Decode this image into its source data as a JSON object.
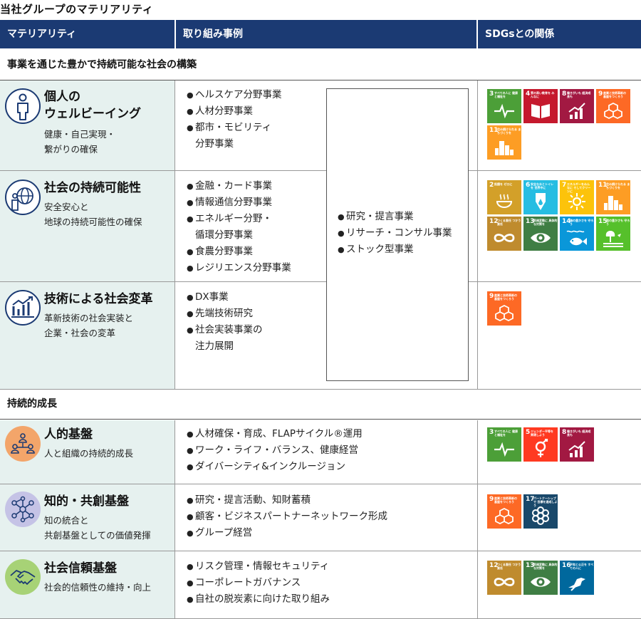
{
  "page_title": "当社グループのマテリアリティ",
  "header": {
    "col1": "マテリアリティ",
    "col2": "取り組み事例",
    "col3": "SDGsとの関係"
  },
  "sections": {
    "s1": "事業を通じた豊かで持続可能な社会の構築",
    "s2": "持続的成長"
  },
  "colors": {
    "header": "#1b3a73",
    "mat_bg": "#e6f1ef",
    "icon_blue": "#1b3a73",
    "icon_orange": "#f3a56a",
    "icon_lavender": "#c5c3e6",
    "icon_green": "#a7d276"
  },
  "rows": [
    {
      "title": "個人の\nウェルビーイング",
      "desc": "健康・自己実現・\n繋がりの確保",
      "icon": "person-icon",
      "items": [
        "ヘルスケア分野事業",
        "人材分野事業",
        "都市・モビリティ\n分野事業"
      ],
      "sdgs": [
        3,
        4,
        8,
        9,
        11
      ]
    },
    {
      "title": "社会の持続可能性",
      "desc": "安全安心と\n地球の持続可能性の確保",
      "icon": "globe-person-icon",
      "items": [
        "金融・カード事業",
        "情報通信分野事業",
        "エネルギー分野・\n循環分野事業",
        "食農分野事業",
        "レジリエンス分野事業"
      ],
      "sdgs": [
        2,
        6,
        7,
        11,
        12,
        13,
        14,
        15
      ]
    },
    {
      "title": "技術による社会変革",
      "desc": "革新技術の社会実装と\n企業・社会の変革",
      "icon": "growth-chart-icon",
      "items": [
        "DX事業",
        "先端技術研究",
        "社会実装事業の\n注力展開"
      ],
      "sdgs": [
        9
      ]
    },
    {
      "title": "人的基盤",
      "desc": "人と組織の持続的成長",
      "icon": "people-network-icon",
      "items": [
        "人材確保・育成、FLAPサイクル®運用",
        "ワーク・ライフ・バランス、健康経営",
        "ダイバーシティ&インクルージョン"
      ],
      "sdgs": [
        3,
        5,
        8
      ]
    },
    {
      "title": "知的・共創基盤",
      "desc": "知の統合と\n共創基盤としての価値発揮",
      "icon": "network-nodes-icon",
      "items": [
        "研究・提言活動、知財蓄積",
        "顧客・ビジネスパートナーネットワーク形成",
        "グループ経営"
      ],
      "sdgs": [
        9,
        17
      ]
    },
    {
      "title": "社会信頼基盤",
      "desc": "社会的信頼性の維持・向上",
      "icon": "handshake-icon",
      "items": [
        "リスク管理・情報セキュリティ",
        "コーポレートガバナンス",
        "自社の脱炭素に向けた取り組み"
      ],
      "sdgs": [
        12,
        13,
        16
      ]
    }
  ],
  "shared_items": [
    "研究・提言事業",
    "リサーチ・コンサル事業",
    "ストック型事業"
  ],
  "sdg_goals": {
    "2": {
      "color": "#d3a029",
      "caption": "飢餓を ゼロに",
      "icon": "bowl-icon"
    },
    "3": {
      "color": "#4c9f38",
      "caption": "すべての人に 健康と福祉を",
      "icon": "heartbeat-icon"
    },
    "4": {
      "color": "#c5192d",
      "caption": "質の高い教育を みんなに",
      "icon": "book-icon"
    },
    "5": {
      "color": "#ff3a21",
      "caption": "ジェンダー平等を 実現しよう",
      "icon": "gender-icon"
    },
    "6": {
      "color": "#26bde2",
      "caption": "安全な水とトイレを 世界中に",
      "icon": "water-drop-icon"
    },
    "7": {
      "color": "#fcc30b",
      "caption": "エネルギーをみんなに そしてクリーンに",
      "icon": "sun-icon"
    },
    "8": {
      "color": "#a21942",
      "caption": "働きがいも 経済成長も",
      "icon": "bar-growth-icon"
    },
    "9": {
      "color": "#fd6925",
      "caption": "産業と技術革新の 基盤をつくろう",
      "icon": "cubes-icon"
    },
    "11": {
      "color": "#fd9d24",
      "caption": "住み続けられる まちづくりを",
      "icon": "buildings-icon"
    },
    "12": {
      "color": "#bf8b2e",
      "caption": "つくる責任 つかう責任",
      "icon": "infinity-icon"
    },
    "13": {
      "color": "#3f7e44",
      "caption": "気候変動に 具体的な対策を",
      "icon": "eye-globe-icon"
    },
    "14": {
      "color": "#0a97d9",
      "caption": "海の豊かさを 守ろう",
      "icon": "fish-icon"
    },
    "15": {
      "color": "#56c02b",
      "caption": "陸の豊かさも 守ろう",
      "icon": "tree-icon"
    },
    "16": {
      "color": "#00689d",
      "caption": "平和と公正を すべての人に",
      "icon": "dove-icon"
    },
    "17": {
      "color": "#19486a",
      "caption": "パートナーシップで 目標を達成しよう",
      "icon": "flower-icon"
    }
  }
}
